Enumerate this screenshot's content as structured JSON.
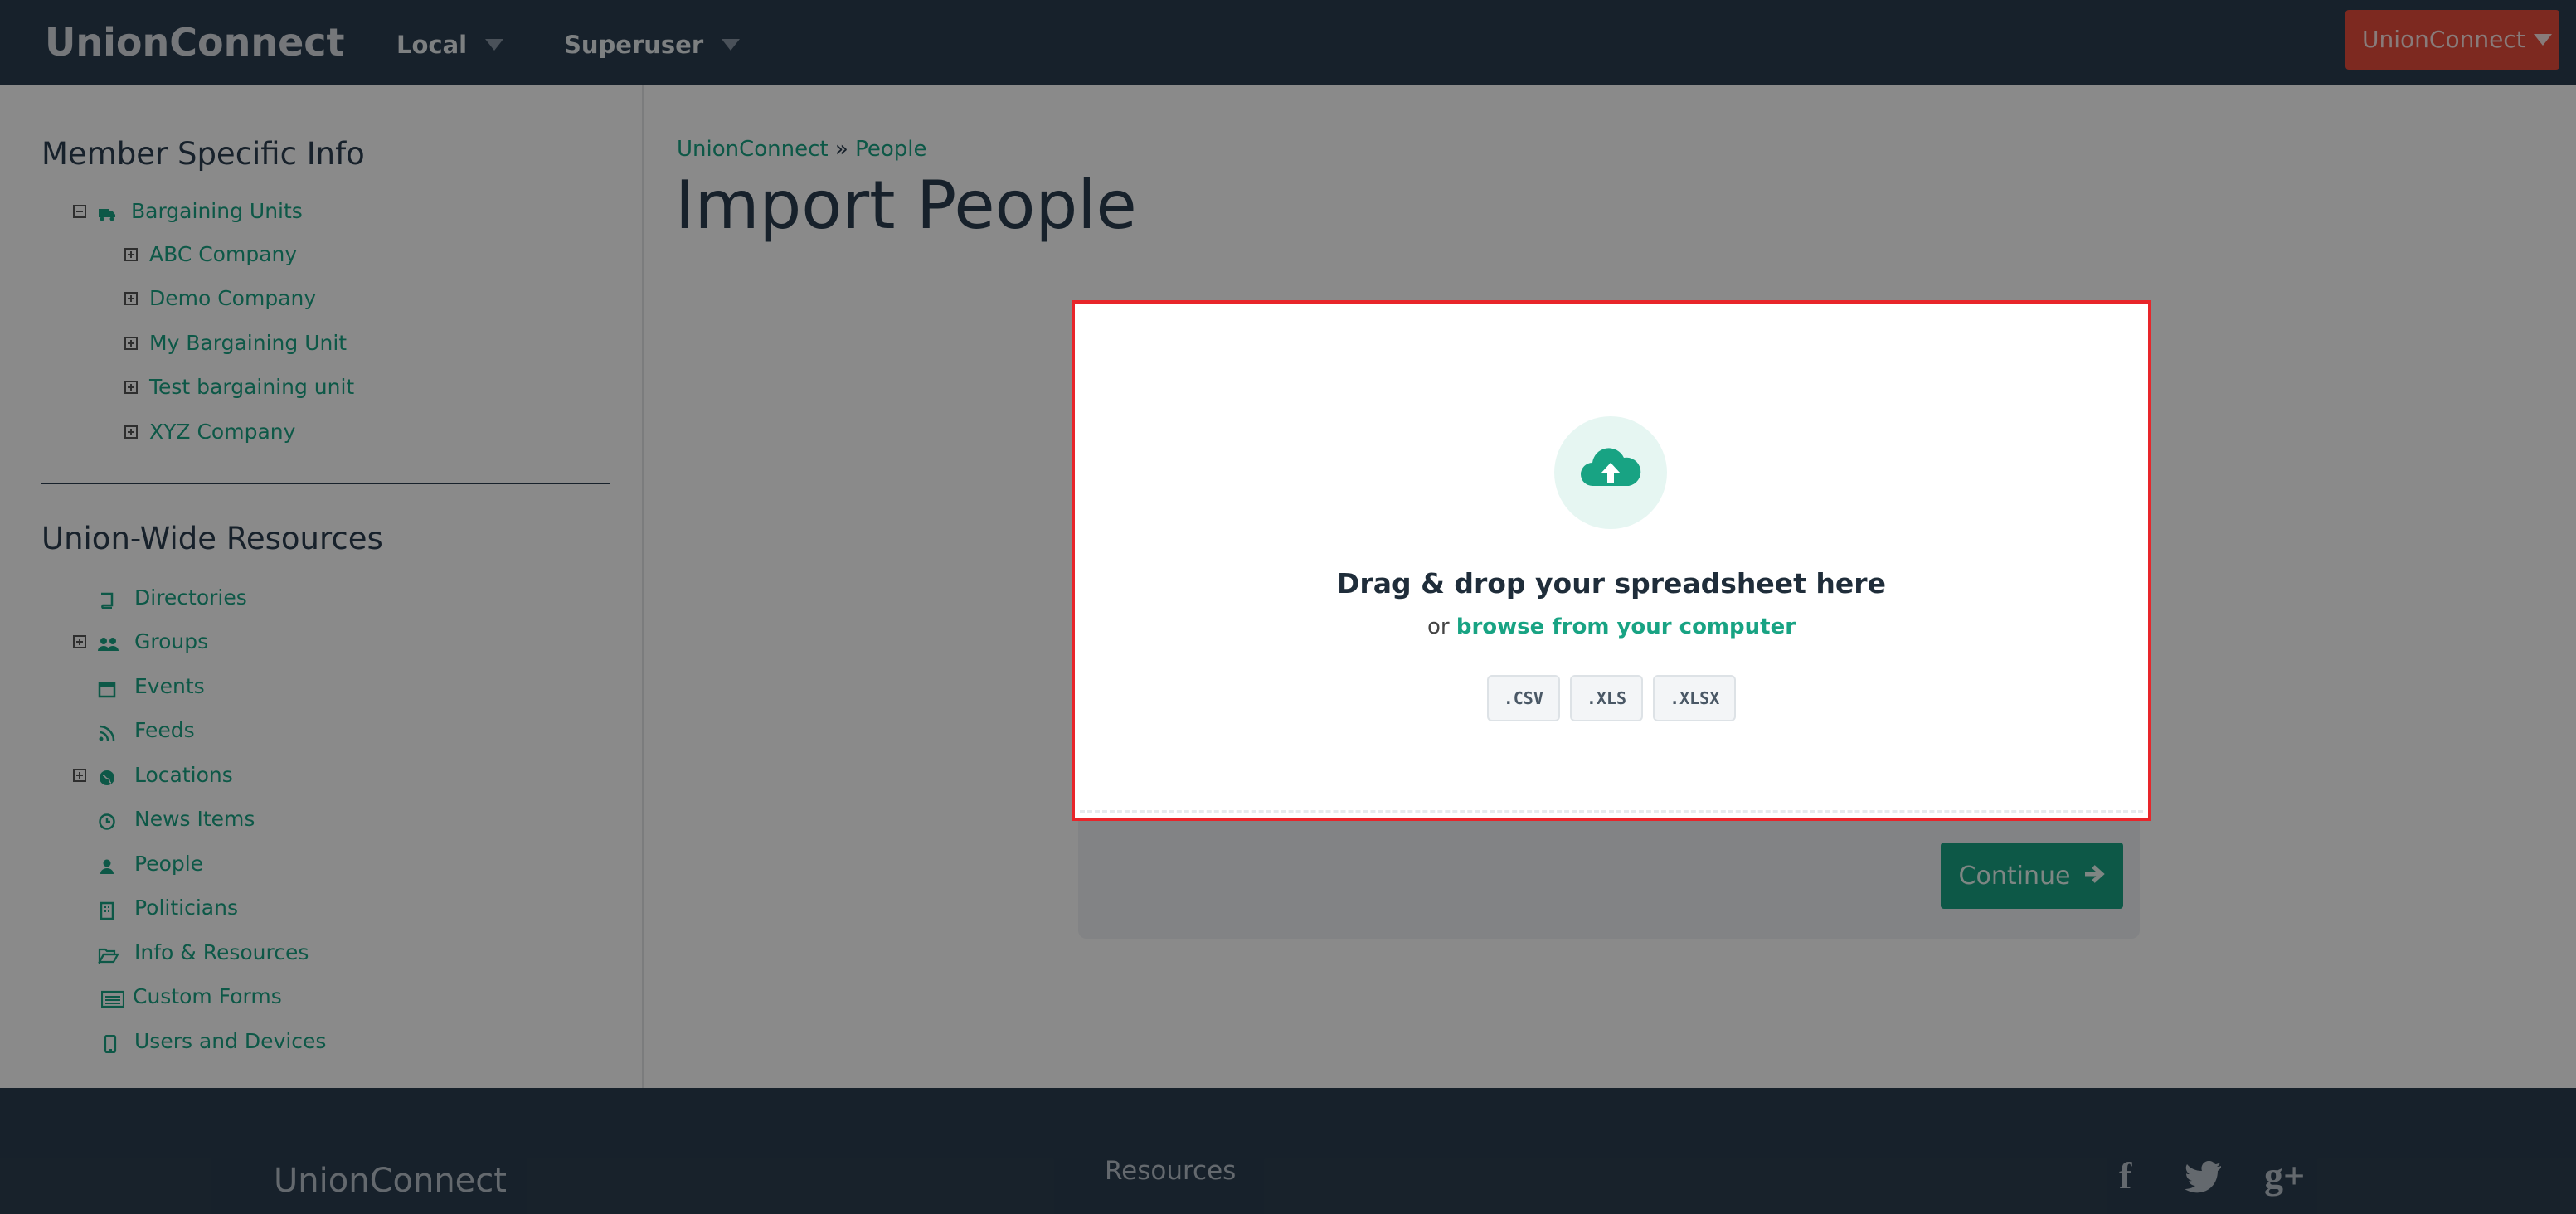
{
  "app": {
    "brand": "UnionConnect"
  },
  "topnav": {
    "items": [
      {
        "label": "Local"
      },
      {
        "label": "Superuser"
      }
    ],
    "account_button": "UnionConnect"
  },
  "sidebar": {
    "member_heading": "Member Specific Info",
    "bargaining": {
      "label": "Bargaining Units",
      "children": [
        {
          "label": "ABC Company"
        },
        {
          "label": "Demo Company"
        },
        {
          "label": "My Bargaining Unit"
        },
        {
          "label": "Test bargaining unit"
        },
        {
          "label": "XYZ Company"
        }
      ]
    },
    "resources_heading": "Union-Wide Resources",
    "resources": [
      {
        "label": "Directories",
        "icon": "book-icon"
      },
      {
        "label": "Groups",
        "icon": "users-icon"
      },
      {
        "label": "Events",
        "icon": "calendar-icon"
      },
      {
        "label": "Feeds",
        "icon": "rss-icon"
      },
      {
        "label": "Locations",
        "icon": "globe-icon"
      },
      {
        "label": "News Items",
        "icon": "clock-icon"
      },
      {
        "label": "People",
        "icon": "user-icon"
      },
      {
        "label": "Politicians",
        "icon": "building-icon"
      },
      {
        "label": "Info & Resources",
        "icon": "folder-open-icon"
      },
      {
        "label": "Custom Forms",
        "icon": "list-alt-icon"
      },
      {
        "label": "Users and Devices",
        "icon": "mobile-icon"
      }
    ]
  },
  "breadcrumb": {
    "root": "UnionConnect",
    "separator": "»",
    "current": "People"
  },
  "page": {
    "title": "Import People"
  },
  "upload_modal": {
    "title": "Drag & drop your spreadsheet here",
    "sub_prefix": "or",
    "browse_link": "browse from your computer",
    "file_types": [
      ".CSV",
      ".XLS",
      ".XLSX"
    ]
  },
  "actions": {
    "continue_label": "Continue"
  },
  "footer": {
    "brand": "UnionConnect",
    "resources_label": "Resources"
  },
  "colors": {
    "accent": "#18a383",
    "nav_bg": "#2c3e50",
    "danger": "#e74c3c",
    "modal_border": "#e8252a"
  }
}
